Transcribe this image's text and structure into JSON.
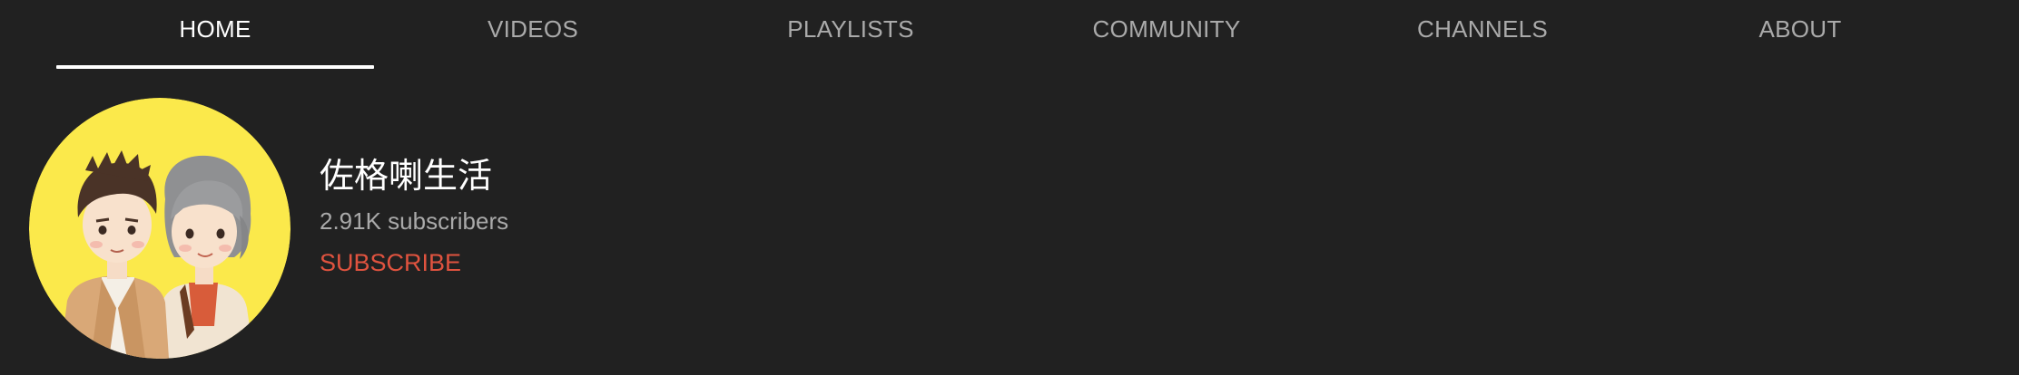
{
  "tabs": [
    {
      "label": "HOME",
      "active": true
    },
    {
      "label": "VIDEOS"
    },
    {
      "label": "PLAYLISTS"
    },
    {
      "label": "COMMUNITY"
    },
    {
      "label": "CHANNELS"
    },
    {
      "label": "ABOUT"
    }
  ],
  "channel": {
    "name": "佐格喇生活",
    "subscribers": "2.91K subscribers",
    "subscribe_label": "SUBSCRIBE",
    "avatar_icon": "cartoon-couple-avatar"
  },
  "colors": {
    "background": "#212121",
    "active_tab": "#ffffff",
    "inactive_tab": "#aaaaaa",
    "subscribe": "#e0533f",
    "avatar_bg": "#fbe94b"
  }
}
